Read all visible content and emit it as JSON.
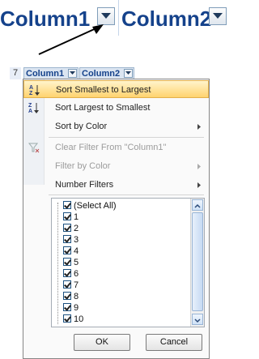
{
  "zoom": {
    "col1": "Column1",
    "col2": "Column2"
  },
  "mini": {
    "row_number": "7",
    "col1": "Column1",
    "col2": "Column2"
  },
  "menu": {
    "sort_asc": "Sort Smallest to Largest",
    "sort_desc": "Sort Largest to Smallest",
    "sort_color": "Sort by Color",
    "clear_filter": "Clear Filter From \"Column1\"",
    "filter_color": "Filter by Color",
    "number_filters": "Number Filters"
  },
  "list": {
    "items": [
      "(Select All)",
      "1",
      "2",
      "3",
      "4",
      "5",
      "6",
      "7",
      "8",
      "9",
      "10"
    ]
  },
  "buttons": {
    "ok": "OK",
    "cancel": "Cancel"
  },
  "icons": {
    "sort_asc": "sort-az-icon",
    "sort_desc": "sort-za-icon",
    "clear_filter": "clear-filter-icon",
    "submenu": "chevron-right-icon",
    "dropdown": "dropdown-arrow-icon"
  },
  "colors": {
    "header_text": "#15428b",
    "highlight": "#ffd36f"
  }
}
